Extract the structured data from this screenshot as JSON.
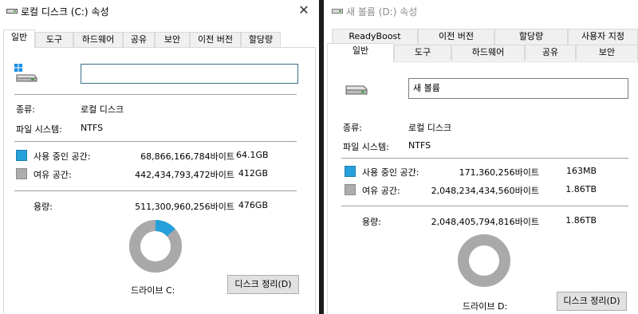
{
  "colors": {
    "used": "#26a0da",
    "free": "#adadad"
  },
  "left": {
    "title": "로컬 디스크 (C:) 속성",
    "tabs": [
      "일반",
      "도구",
      "하드웨어",
      "공유",
      "보안",
      "이전 버전",
      "할당량"
    ],
    "name_value": "",
    "type_label": "종류:",
    "type_value": "로컬 디스크",
    "fs_label": "파일 시스템:",
    "fs_value": "NTFS",
    "used_label": "사용 중인 공간:",
    "used_bytes": "68,866,166,784바이트",
    "used_size": "64.1GB",
    "free_label": "여유 공간:",
    "free_bytes": "442,434,793,472바이트",
    "free_size": "412GB",
    "capacity_label": "용량:",
    "capacity_bytes": "511,300,960,256바이트",
    "capacity_size": "476GB",
    "drive_label": "드라이브 C:",
    "cleanup_button": "디스크 정리(D)",
    "used_fraction": 0.135
  },
  "right": {
    "title": "새 볼륨 (D:) 속성",
    "tabs_back": [
      "ReadyBoost",
      "이전 버전",
      "할당량",
      "사용자 지정"
    ],
    "tabs_front": [
      "일반",
      "도구",
      "하드웨어",
      "공유",
      "보안"
    ],
    "name_value": "새 볼륨",
    "type_label": "종류:",
    "type_value": "로컬 디스크",
    "fs_label": "파일 시스템:",
    "fs_value": "NTFS",
    "used_label": "사용 중인 공간:",
    "used_bytes": "171,360,256바이트",
    "used_size": "163MB",
    "free_label": "여유 공간:",
    "free_bytes": "2,048,234,434,560바이트",
    "free_size": "1.86TB",
    "capacity_label": "용량:",
    "capacity_bytes": "2,048,405,794,816바이트",
    "capacity_size": "1.86TB",
    "drive_label": "드라이브 D:",
    "cleanup_button": "디스크 정리(D)",
    "used_fraction": 0.0001
  }
}
